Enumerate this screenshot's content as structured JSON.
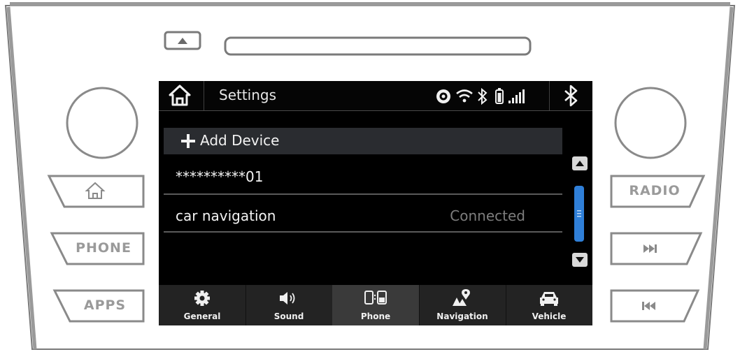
{
  "hardware": {
    "left_buttons": [
      "PHONE",
      "APPS"
    ],
    "right_buttons": [
      "RADIO"
    ],
    "home_icon": "home-icon",
    "eject_icon": "eject-icon",
    "next_icon": "skip-forward-icon",
    "prev_icon": "skip-back-icon"
  },
  "screen": {
    "title": "Settings",
    "status_icons": [
      "sirius-icon",
      "wifi-icon",
      "bluetooth-icon",
      "battery-icon",
      "signal-icon"
    ],
    "add_device_label": "Add Device",
    "devices": [
      {
        "name": "**********01",
        "status": ""
      },
      {
        "name": "car navigation",
        "status": "Connected"
      }
    ],
    "tabs": [
      {
        "label": "General",
        "icon": "gear-icon",
        "active": false
      },
      {
        "label": "Sound",
        "icon": "speaker-icon",
        "active": false
      },
      {
        "label": "Phone",
        "icon": "phone-icon",
        "active": true
      },
      {
        "label": "Navigation",
        "icon": "map-pin-icon",
        "active": false
      },
      {
        "label": "Vehicle",
        "icon": "car-icon",
        "active": false
      }
    ]
  },
  "colors": {
    "scroll_thumb": "#2f7fd8",
    "active_tab": "#3a3a3a"
  }
}
